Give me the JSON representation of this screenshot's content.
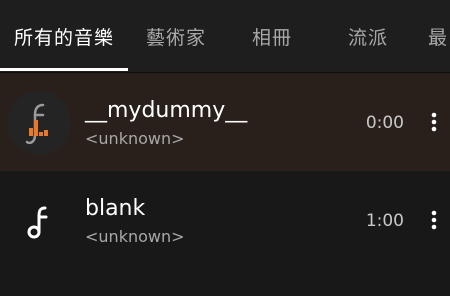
{
  "tabs": [
    {
      "label": "所有的音樂",
      "active": true
    },
    {
      "label": "藝術家",
      "active": false
    },
    {
      "label": "相冊",
      "active": false
    },
    {
      "label": "流派",
      "active": false
    },
    {
      "label": "最",
      "active": false
    }
  ],
  "colors": {
    "accent": "#e8782b",
    "playing_row_bg": "#2a201b",
    "background": "#181818",
    "tabbar_bg": "#1e1e1e"
  },
  "songs": [
    {
      "title": "__mydummy__",
      "artist": "<unknown>",
      "duration": "0:00",
      "playing": true,
      "icon": "equalizer-note-icon",
      "menu_icon": "more-vert-icon"
    },
    {
      "title": "blank",
      "artist": "<unknown>",
      "duration": "1:00",
      "playing": false,
      "icon": "music-note-icon",
      "menu_icon": "more-vert-icon"
    }
  ]
}
